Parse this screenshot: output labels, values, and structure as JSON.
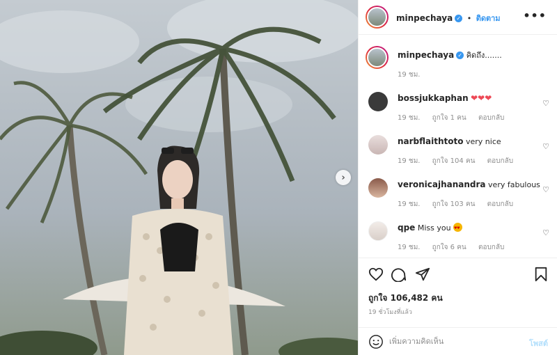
{
  "post": {
    "username": "minpechaya",
    "follow_label": "ติดตาม",
    "more_label": "•••",
    "verified_mark": "✓",
    "next_label": "›"
  },
  "caption": {
    "username": "minpechaya",
    "text": "คิดถึง.......",
    "time": "19 ชม."
  },
  "comments": [
    {
      "username": "bossjukkaphan",
      "text": "",
      "emoji": "❤❤❤",
      "time": "19 ชม.",
      "likes": "ถูกใจ 1 คน",
      "reply": "ตอบกลับ"
    },
    {
      "username": "narbflaithtoto",
      "text": "very nice",
      "time": "19 ชม.",
      "likes": "ถูกใจ 104 คน",
      "reply": "ตอบกลับ"
    },
    {
      "username": "veronicajhanandra",
      "text": "very fabulous",
      "time": "19 ชม.",
      "likes": "ถูกใจ 103 คน",
      "reply": "ตอบกลับ"
    },
    {
      "username": "qpe",
      "text": "Miss you",
      "time": "19 ชม.",
      "likes": "ถูกใจ 6 คน",
      "reply": "ตอบกลับ"
    }
  ],
  "actions": {
    "likes_text": "ถูกใจ 106,482 คน",
    "time_ago": "19 ชั่วโมงที่แล้ว"
  },
  "compose": {
    "placeholder": "เพิ่มความคิดเห็น",
    "post_label": "โพสต์"
  },
  "colors": {
    "accent": "#3897f0",
    "heart": "#ed4956",
    "muted": "#8e8e8e"
  },
  "icons": [
    "heart-icon",
    "comment-icon",
    "share-icon",
    "bookmark-icon",
    "smile-icon",
    "more-icon",
    "next-arrow-icon",
    "verified-icon"
  ]
}
